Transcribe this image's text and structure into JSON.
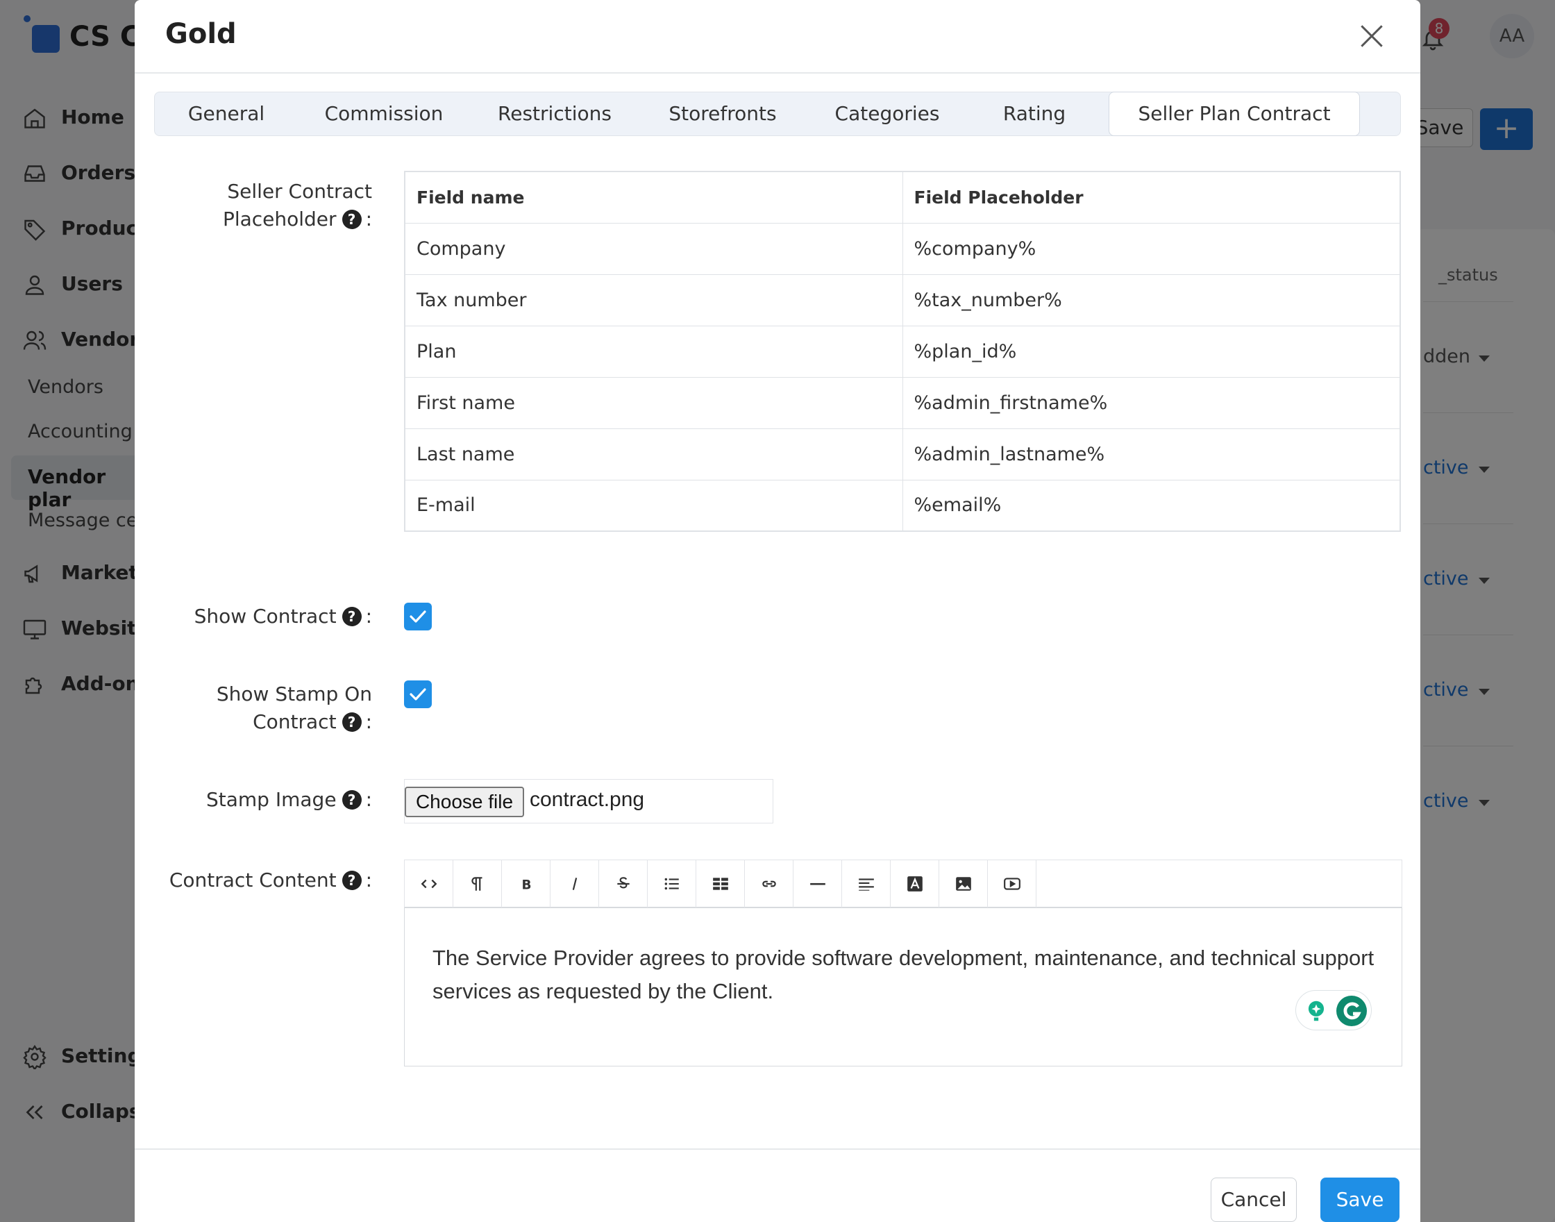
{
  "app": {
    "logo_text": "CS C",
    "notification_count": "8",
    "avatar_initials": "AA"
  },
  "sidebar": {
    "items": [
      {
        "label": "Home",
        "icon": "home-icon"
      },
      {
        "label": "Orders",
        "icon": "inbox-icon"
      },
      {
        "label": "Product",
        "icon": "tag-icon"
      },
      {
        "label": "Users",
        "icon": "user-icon"
      },
      {
        "label": "Vendors",
        "icon": "users-icon"
      }
    ],
    "sub_items": [
      "Vendors",
      "Accounting",
      "Vendor plar",
      "Message cer"
    ],
    "items2": [
      {
        "label": "Marketi",
        "icon": "megaphone-icon"
      },
      {
        "label": "Website",
        "icon": "monitor-icon"
      },
      {
        "label": "Add-ons",
        "icon": "puzzle-icon"
      }
    ],
    "bottom": [
      {
        "label": "Settings",
        "icon": "gear-icon"
      },
      {
        "label": "Collapse",
        "icon": "double-chevron-left-icon"
      }
    ]
  },
  "background": {
    "save_label": "Save",
    "add_label": "+",
    "status_header": "_status",
    "statuses": [
      "dden",
      "ctive",
      "ctive",
      "ctive",
      "ctive"
    ]
  },
  "modal": {
    "title": "Gold",
    "tabs": [
      "General",
      "Commission",
      "Restrictions",
      "Storefronts",
      "Categories",
      "Rating",
      "Seller Plan Contract"
    ],
    "active_tab": "Seller Plan Contract",
    "placeholder_label_line1": "Seller Contract",
    "placeholder_label_line2": "Placeholder",
    "table": {
      "headers": [
        "Field name",
        "Field Placeholder"
      ],
      "rows": [
        [
          "Company",
          "%company%"
        ],
        [
          "Tax number",
          "%tax_number%"
        ],
        [
          "Plan",
          "%plan_id%"
        ],
        [
          "First name",
          "%admin_firstname%"
        ],
        [
          "Last name",
          "%admin_lastname%"
        ],
        [
          "E-mail",
          "%email%"
        ]
      ]
    },
    "show_contract_label": "Show Contract",
    "show_contract_checked": true,
    "show_stamp_label_line1": "Show Stamp On",
    "show_stamp_label_line2": "Contract",
    "show_stamp_checked": true,
    "stamp_image_label": "Stamp Image",
    "choose_file_label": "Choose file",
    "file_name": "contract.png",
    "contract_content_label": "Contract Content",
    "editor_toolbar": [
      "code-view",
      "paragraph",
      "bold",
      "italic",
      "strikethrough",
      "unordered-list",
      "table",
      "link",
      "horizontal-rule",
      "align",
      "font-color",
      "image",
      "video"
    ],
    "contract_text": "The Service Provider agrees to provide software development, maintenance, and technical support services as requested by the Client.",
    "help_glyph": "?",
    "colon": ":",
    "cancel_label": "Cancel",
    "save_label": "Save"
  },
  "colors": {
    "accent": "#1f8fe6",
    "primary_dark": "#1f72d4",
    "badge": "#e0475a",
    "overlay": "rgba(0,0,0,0.5)"
  }
}
